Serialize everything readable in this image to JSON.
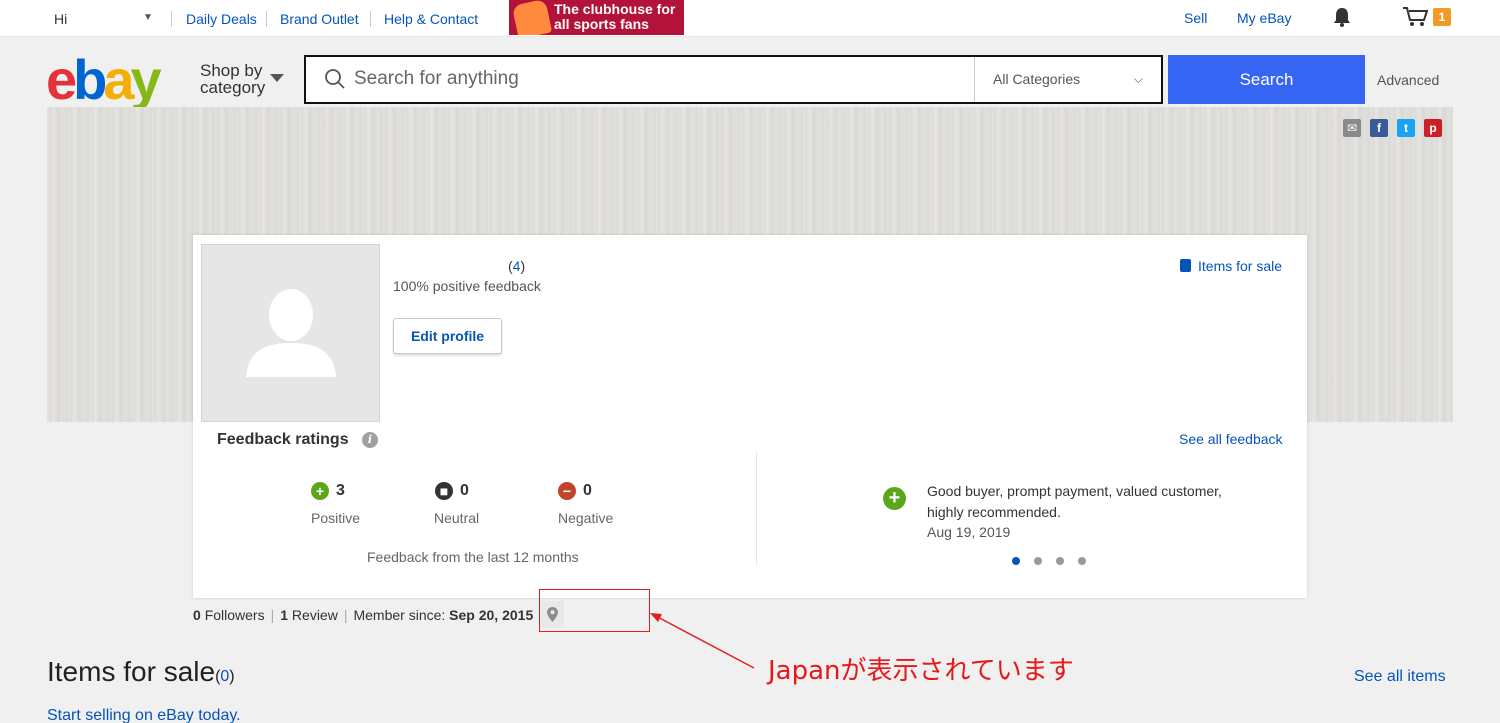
{
  "topbar": {
    "greeting": "Hi",
    "nav": [
      "Daily Deals",
      "Brand Outlet",
      "Help & Contact"
    ],
    "promo_text": "The clubhouse for all sports fans",
    "sell": "Sell",
    "my_ebay": "My eBay",
    "cart_count": "1"
  },
  "header": {
    "logo": {
      "e": "e",
      "b": "b",
      "a": "a",
      "y": "y"
    },
    "shop_by_line1": "Shop by",
    "shop_by_line2": "category",
    "search_placeholder": "Search for anything",
    "category": "All Categories",
    "search_button": "Search",
    "advanced": "Advanced"
  },
  "profile": {
    "feedback_count": "4",
    "positive_feedback": "100% positive feedback",
    "edit_profile": "Edit profile",
    "items_for_sale_link": "Items for sale"
  },
  "feedback": {
    "title": "Feedback ratings",
    "see_all": "See all feedback",
    "ratings": [
      {
        "count": "3",
        "label": "Positive"
      },
      {
        "count": "0",
        "label": "Neutral"
      },
      {
        "count": "0",
        "label": "Negative"
      }
    ],
    "period": "Feedback from the last 12 months",
    "comment": "Good buyer, prompt payment, valued customer, highly recommended.",
    "comment_date": "Aug 19, 2019"
  },
  "member": {
    "followers_count": "0",
    "followers_label": "Followers",
    "reviews_count": "1",
    "reviews_label": "Review",
    "since_label": "Member since:",
    "since_date": "Sep 20, 2015"
  },
  "annotation": {
    "text": "Japanが表示されています"
  },
  "items": {
    "title": "Items for sale",
    "count": "0",
    "see_all": "See all items",
    "start_selling": "Start selling on eBay today."
  },
  "colors": {
    "accent_blue": "#3665f3",
    "link_blue": "#0654ba",
    "annotation_red": "#e81818",
    "positive_green": "#5ba71b",
    "negative_red": "#c1452a"
  }
}
